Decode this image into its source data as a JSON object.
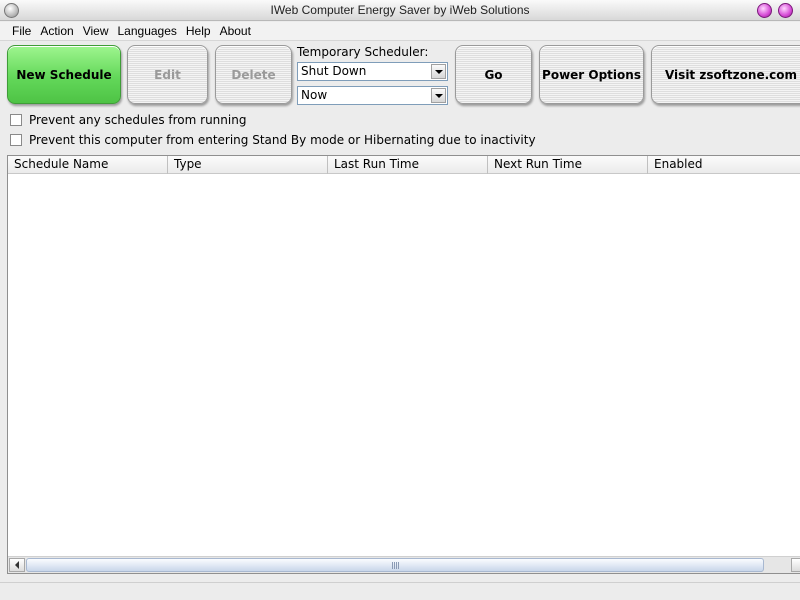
{
  "window": {
    "title": "IWeb Computer Energy Saver by iWeb Solutions"
  },
  "menu": {
    "items": [
      "File",
      "Action",
      "View",
      "Languages",
      "Help",
      "About"
    ]
  },
  "toolbar": {
    "new_schedule": "New Schedule",
    "edit": "Edit",
    "delete": "Delete",
    "go": "Go",
    "power_options": "Power Options",
    "visit": "Visit zsoftzone.com"
  },
  "scheduler": {
    "label": "Temporary Scheduler:",
    "action_value": "Shut Down",
    "time_value": "Now"
  },
  "options": {
    "prevent_schedules": "Prevent any schedules from running",
    "prevent_standby": "Prevent this computer from entering Stand By mode or Hibernating due to inactivity"
  },
  "table": {
    "columns": [
      "Schedule Name",
      "Type",
      "Last Run Time",
      "Next Run Time",
      "Enabled"
    ],
    "rows": []
  },
  "colors": {
    "new_button_green": "#63d85a",
    "window_buttons_magenta": "#d64bd6",
    "disabled_text": "#9a9a9a"
  }
}
